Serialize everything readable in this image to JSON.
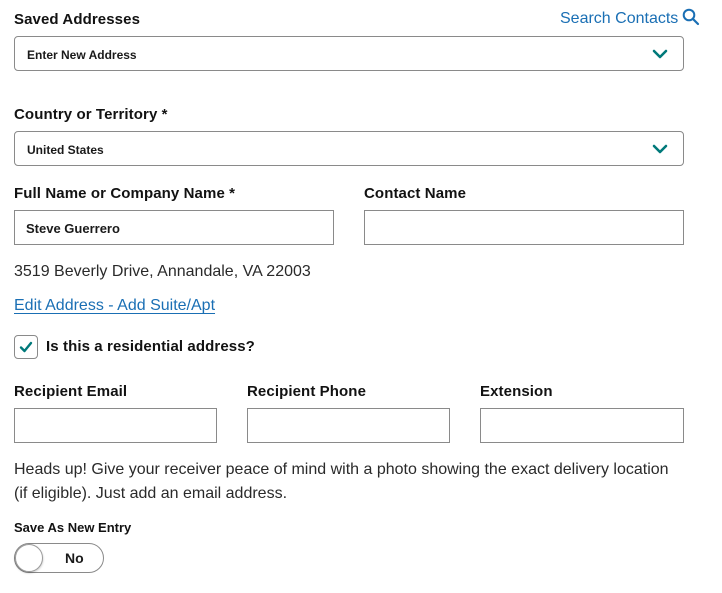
{
  "saved_addresses": {
    "label": "Saved Addresses",
    "search_link": "Search Contacts",
    "selected": "Enter New Address"
  },
  "country": {
    "label": "Country or Territory *",
    "selected": "United States"
  },
  "full_name": {
    "label": "Full Name or Company Name *",
    "value": "Steve Guerrero"
  },
  "contact_name": {
    "label": "Contact Name",
    "value": ""
  },
  "address_text": "3519 Beverly Drive, Annandale, VA 22003",
  "edit_address_link": "Edit Address - Add Suite/Apt",
  "residential": {
    "label": "Is this a residential address?",
    "checked": true
  },
  "recipient_email": {
    "label": "Recipient Email",
    "value": ""
  },
  "recipient_phone": {
    "label": "Recipient Phone",
    "value": ""
  },
  "extension": {
    "label": "Extension",
    "value": ""
  },
  "heads_up": {
    "line1": "Heads up! Give your receiver peace of mind with a photo showing the exact delivery location",
    "line2": "(if eligible). Just add an email address."
  },
  "save_entry": {
    "label": "Save As New Entry",
    "toggle_text": "No"
  },
  "colors": {
    "accent_teal": "#00797a",
    "link_blue": "#1a6fb4",
    "border_gray": "#8a8a8a"
  },
  "icons": {
    "search": "search-icon",
    "chevron": "chevron-down-icon",
    "check": "check-icon"
  }
}
